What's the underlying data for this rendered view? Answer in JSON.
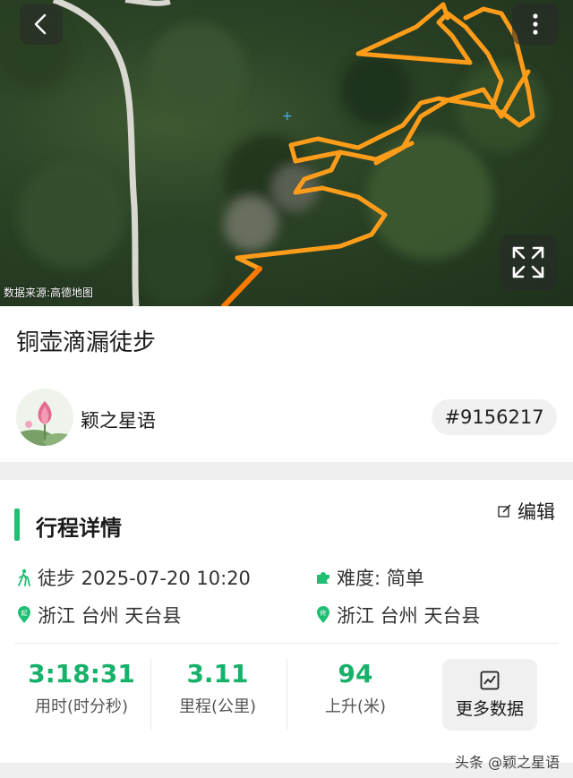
{
  "map": {
    "source_text": "数据来源:高德地图",
    "back_icon": "chevron-left-icon",
    "more_icon": "more-vertical-icon",
    "expand_icon": "fullscreen-expand-icon",
    "route_color": "#ff9c1a",
    "route_color_dark": "#ff7a00"
  },
  "trip": {
    "title": "铜壶滴漏徒步",
    "username": "颖之星语",
    "id_badge": "#9156217"
  },
  "details": {
    "edit_label": "编辑",
    "section_title": "行程详情",
    "activity": "徒步 2025-07-20 10:20",
    "difficulty": "难度:  简单",
    "start_location": "浙江 台州 天台县",
    "end_location": "浙江 台州 天台县",
    "accent": "#1fbf73"
  },
  "stats": [
    {
      "value": "3:18:31",
      "label": "用时(时分秒)"
    },
    {
      "value": "3.11",
      "label": "里程(公里)"
    },
    {
      "value": "94",
      "label": "上升(米)"
    }
  ],
  "more_data_label": "更多数据",
  "watermark": "头条 @颖之星语"
}
